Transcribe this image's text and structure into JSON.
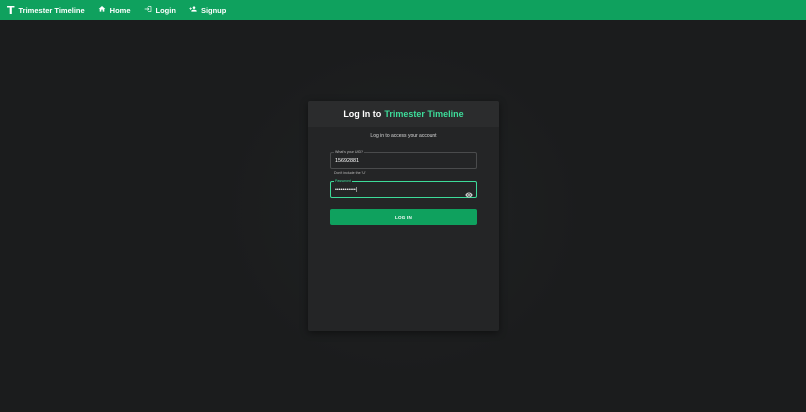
{
  "navbar": {
    "brand_logo": "T",
    "brand_name": "Trimester Timeline",
    "items": [
      {
        "label": "Home",
        "icon": "home-icon"
      },
      {
        "label": "Login",
        "icon": "login-icon"
      },
      {
        "label": "Signup",
        "icon": "person-add-icon"
      }
    ],
    "color": "#0fa15e"
  },
  "login_card": {
    "title_prefix": "Log In to",
    "title_accent": "Trimester Timeline",
    "subtitle": "Log in to access your account",
    "uid_field": {
      "label": "What's your UID?",
      "value": "15692881",
      "helper": "Don't include the 'U'"
    },
    "password_field": {
      "label": "Password",
      "value": "•••••••••••|"
    },
    "submit_label": "LOG IN",
    "accent_color": "#3ddc9a"
  }
}
